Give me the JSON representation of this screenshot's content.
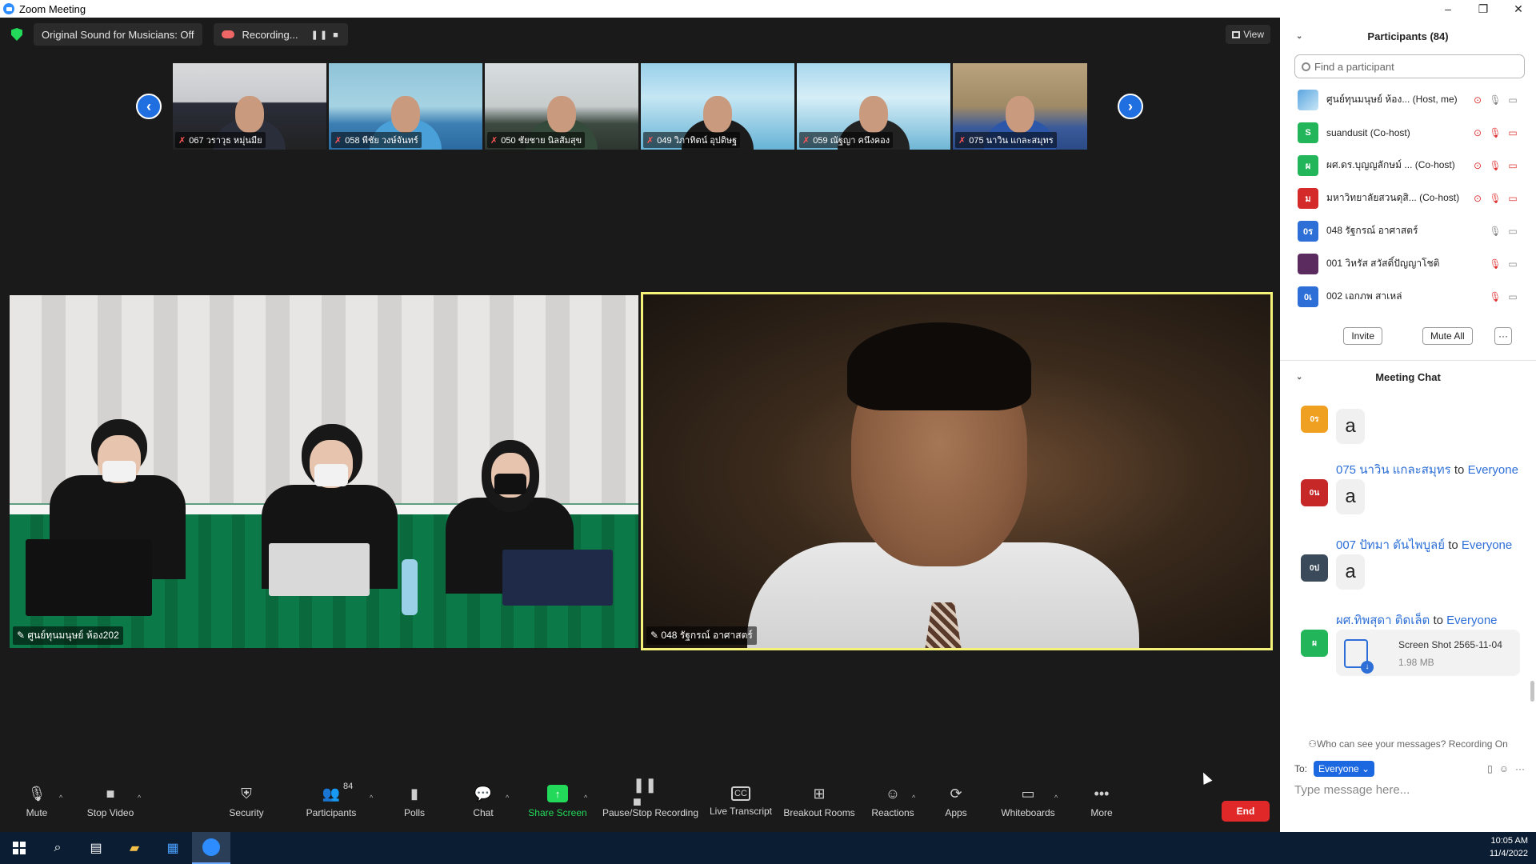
{
  "window": {
    "title": "Zoom Meeting",
    "minimize": "–",
    "restore": "❐",
    "close": "✕"
  },
  "topbar": {
    "original_sound": "Original Sound for Musicians: Off",
    "recording": "Recording...",
    "pause_stop": "❚❚ ■",
    "view": "View"
  },
  "strip": {
    "prev": "‹",
    "next": "›",
    "thumbs": [
      {
        "name": "067 วราวุธ หมุ่นมีย"
      },
      {
        "name": "058 พีชัย วงษ์จันทร์"
      },
      {
        "name": "050 ชัยชาย นิลสัมสุข"
      },
      {
        "name": "049 วิภาทิตน์ อุปติษฐ"
      },
      {
        "name": "059 ณัฐญา คนึงคอง"
      },
      {
        "name": "075 นาวิน แกละสมุทร"
      }
    ]
  },
  "videos": {
    "left_name": "ศูนย์ทุนมนุษย์ ห้อง202",
    "right_name": "048 รัฐกรณ์ อาศาสตร์"
  },
  "toolbar": {
    "mute": "Mute",
    "stop_video": "Stop Video",
    "security": "Security",
    "participants": "Participants",
    "participants_count": "84",
    "polls": "Polls",
    "chat": "Chat",
    "share_screen": "Share Screen",
    "pause_stop_recording": "Pause/Stop Recording",
    "live_transcript": "Live Transcript",
    "breakout_rooms": "Breakout Rooms",
    "reactions": "Reactions",
    "apps": "Apps",
    "whiteboards": "Whiteboards",
    "more": "More",
    "end": "End",
    "caret": "^"
  },
  "participants": {
    "header": "Participants (84)",
    "search_placeholder": "Find a participant",
    "list": [
      {
        "name": "ศูนย์ทุนมนุษย์ ห้อง... (Host, me)",
        "avatar": "",
        "color": "#5aa5e0"
      },
      {
        "name": "suandusit (Co-host)",
        "avatar": "S",
        "color": "#23b55a"
      },
      {
        "name": "ผศ.ดร.บุญญลักษม์ ... (Co-host)",
        "avatar": "ผ",
        "color": "#23b55a"
      },
      {
        "name": "มหาวิทยาลัยสวนดุสิ... (Co-host)",
        "avatar": "ม",
        "color": "#d42a2a"
      },
      {
        "name": "048 รัฐกรณ์ อาศาสตร์",
        "avatar": "0ร",
        "color": "#2d6fd6"
      },
      {
        "name": "001 วิหรัส สวัสดิ์ปัญญาโชติ",
        "avatar": "",
        "color": "#5b2a5e"
      },
      {
        "name": "002 เอกภพ สาเหล่",
        "avatar": "0เ",
        "color": "#2d6fd6"
      }
    ],
    "invite": "Invite",
    "mute_all": "Mute All",
    "more": "···"
  },
  "chat": {
    "header": "Meeting Chat",
    "to_word": "to",
    "messages": [
      {
        "sender": "",
        "to": "",
        "text": "a",
        "avatar": "0ร",
        "color": "#f0a020"
      },
      {
        "sender": "075 นาวิน แกละสมุทร",
        "to": "Everyone",
        "text": "a",
        "avatar": "0น",
        "color": "#c62828"
      },
      {
        "sender": "007 ปัทมา ตันไพบูลย์",
        "to": "Everyone",
        "text": "a",
        "avatar": "0ป",
        "color": "#3a4a5a"
      },
      {
        "sender": "ผศ.ทิพสุดา ติดเล็ต",
        "to": "Everyone",
        "file_name": "Screen Shot 2565-11-04",
        "file_size": "1.98 MB",
        "avatar": "ผ",
        "color": "#23b55a"
      }
    ],
    "who_can_see": "Who can see your messages? Recording On",
    "to_label": "To:",
    "to_value": "Everyone ⌄",
    "placeholder": "Type message here..."
  },
  "taskbar": {
    "time": "10:05 AM",
    "date": "11/4/2022"
  }
}
